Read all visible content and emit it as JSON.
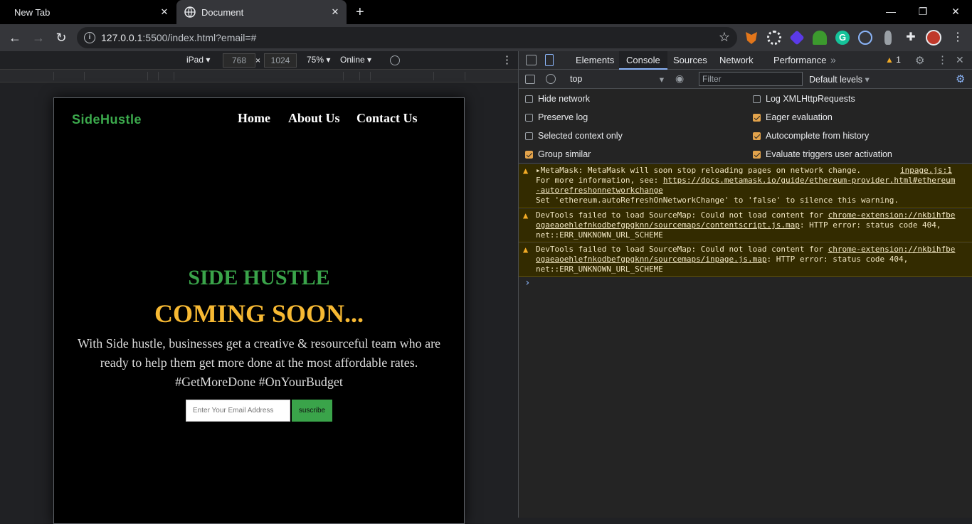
{
  "tabs": [
    {
      "title": "New Tab"
    },
    {
      "title": "Document"
    }
  ],
  "address": {
    "host": "127.0.0.1",
    "rest": ":5500/index.html?email=#"
  },
  "device_toolbar": {
    "device": "iPad",
    "width": "768",
    "height": "1024",
    "zoom": "75%",
    "network": "Online"
  },
  "site": {
    "logo": "SideHustle",
    "nav": [
      "Home",
      "About Us",
      "Contact Us"
    ],
    "hero_title": "SIDE HUSTLE",
    "hero_subtitle": "COMING SOON...",
    "hero_desc": "With Side hustle, businesses get a creative & resourceful team who are ready to help them get more done at the most affordable rates. #GetMoreDone #OnYourBudget",
    "email_placeholder": "Enter Your Email Address",
    "subscribe_label": "suscribe"
  },
  "devtools": {
    "tabs": [
      "Elements",
      "Console",
      "Sources",
      "Network",
      "Performance"
    ],
    "warning_count": "1",
    "context": "top",
    "filter_placeholder": "Filter",
    "levels": "Default levels",
    "options": [
      {
        "label": "Hide network",
        "checked": false
      },
      {
        "label": "Log XMLHttpRequests",
        "checked": false
      },
      {
        "label": "Preserve log",
        "checked": false
      },
      {
        "label": "Eager evaluation",
        "checked": true
      },
      {
        "label": "Selected context only",
        "checked": false
      },
      {
        "label": "Autocomplete from history",
        "checked": true
      },
      {
        "label": "Group similar",
        "checked": true
      },
      {
        "label": "Evaluate triggers user activation",
        "checked": true
      }
    ],
    "messages": [
      {
        "line1": "▸MetaMask: MetaMask will soon stop reloading pages on network change.",
        "source": "inpage.js:1",
        "line2_prefix": "For more information, see: ",
        "line2_link": "https://docs.metamask.io/guide/ethereum-provider.html#ethereum",
        "line3_link": "-autorefreshonnetworkchange",
        "line4": "Set 'ethereum.autoRefreshOnNetworkChange' to 'false' to silence this warning."
      },
      {
        "line1_prefix": "DevTools failed to load SourceMap: Could not load content for ",
        "line1_link": "chrome-extension://nkbihfbe",
        "line2_link": "ogaeaoehlefnkodbefgpgknn/sourcemaps/contentscript.js.map",
        "line2_suffix": ": HTTP error: status code 404,",
        "line3": "net::ERR_UNKNOWN_URL_SCHEME"
      },
      {
        "line1_prefix": "DevTools failed to load SourceMap: Could not load content for ",
        "line1_link": "chrome-extension://nkbihfbe",
        "line2_link": "ogaeaoehlefnkodbefgpgknn/sourcemaps/inpage.js.map",
        "line2_suffix": ": HTTP error: status code 404,",
        "line3": "net::ERR_UNKNOWN_URL_SCHEME"
      }
    ]
  },
  "colors": {
    "brand_green": "#3aa44a",
    "brand_yellow": "#f7b933",
    "warn_bg": "#332b00"
  }
}
